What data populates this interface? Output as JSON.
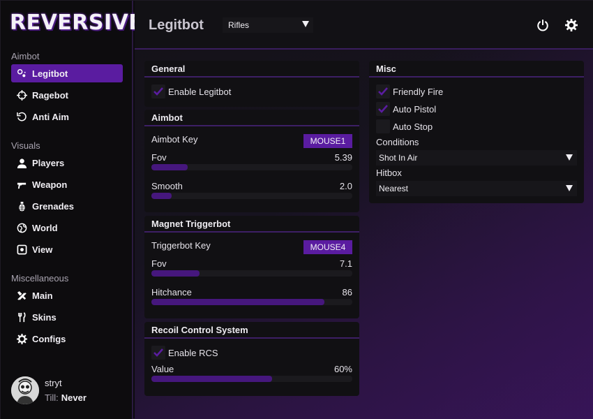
{
  "app": {
    "logo": "REVERSIVE"
  },
  "sidebar": {
    "sections": [
      {
        "title": "Aimbot",
        "items": [
          {
            "label": "Legitbot",
            "icon": "target-hit-icon",
            "active": true
          },
          {
            "label": "Ragebot",
            "icon": "crosshair-icon"
          },
          {
            "label": "Anti Aim",
            "icon": "rotate-icon"
          }
        ]
      },
      {
        "title": "Visuals",
        "items": [
          {
            "label": "Players",
            "icon": "user-icon"
          },
          {
            "label": "Weapon",
            "icon": "gun-icon"
          },
          {
            "label": "Grenades",
            "icon": "grenade-icon"
          },
          {
            "label": "World",
            "icon": "globe-icon"
          },
          {
            "label": "View",
            "icon": "camera-icon"
          }
        ]
      },
      {
        "title": "Miscellaneous",
        "items": [
          {
            "label": "Main",
            "icon": "tools-icon"
          },
          {
            "label": "Skins",
            "icon": "cutlery-icon"
          },
          {
            "label": "Configs",
            "icon": "gear-icon"
          }
        ]
      }
    ],
    "user": {
      "name": "stryt",
      "till_label": "Till:",
      "till_value": "Never"
    }
  },
  "header": {
    "title": "Legitbot",
    "weapon": "Rifles"
  },
  "panels": {
    "general": {
      "title": "General",
      "enable_label": "Enable Legitbot",
      "enabled": true
    },
    "aimbot": {
      "title": "Aimbot",
      "key_label": "Aimbot Key",
      "key": "MOUSE1",
      "fov_label": "Fov",
      "fov": "5.39",
      "fov_fraction": 0.18,
      "smooth_label": "Smooth",
      "smooth": "2.0",
      "smooth_fraction": 0.1
    },
    "trigger": {
      "title": "Magnet Triggerbot",
      "key_label": "Triggerbot Key",
      "key": "MOUSE4",
      "fov_label": "Fov",
      "fov": "7.1",
      "fov_fraction": 0.24,
      "hit_label": "Hitchance",
      "hit": "86",
      "hit_fraction": 0.86
    },
    "rcs": {
      "title": "Recoil Control System",
      "enable_label": "Enable RCS",
      "enabled": true,
      "value_label": "Value",
      "value": "60%",
      "value_fraction": 0.6
    },
    "misc": {
      "title": "Misc",
      "friendly_fire": "Friendly Fire",
      "friendly_fire_on": true,
      "auto_pistol": "Auto Pistol",
      "auto_pistol_on": true,
      "auto_stop": "Auto Stop",
      "auto_stop_on": false,
      "conditions_label": "Conditions",
      "conditions": "Shot In Air",
      "hitbox_label": "Hitbox",
      "hitbox": "Nearest"
    }
  },
  "colors": {
    "accent": "#5a1ca0",
    "slider": "#46177d",
    "divider": "#3d1f65"
  }
}
